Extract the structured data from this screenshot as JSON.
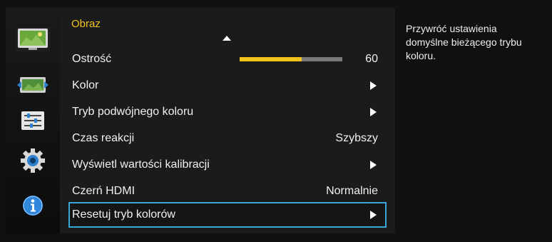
{
  "menu": {
    "title": "Obraz",
    "items": [
      {
        "label": "Ostrość",
        "value": "60",
        "slider_level_percent": 60,
        "kind": "slider"
      },
      {
        "label": "Kolor",
        "kind": "submenu"
      },
      {
        "label": "Tryb podwójnego koloru",
        "kind": "submenu"
      },
      {
        "label": "Czas reakcji",
        "value": "Szybszy",
        "kind": "value"
      },
      {
        "label": "Wyświetl wartości kalibracji",
        "kind": "submenu"
      },
      {
        "label": "Czerń HDMI",
        "value": "Normalnie",
        "kind": "value"
      },
      {
        "label": "Resetuj tryb kolorów",
        "kind": "submenu",
        "selected": true
      }
    ]
  },
  "sidebar": {
    "icons": [
      {
        "name": "picture-icon",
        "selected": true
      },
      {
        "name": "screen-size-icon"
      },
      {
        "name": "settings-sliders-icon"
      },
      {
        "name": "gear-icon"
      },
      {
        "name": "info-icon"
      }
    ]
  },
  "description": {
    "text": "Przywróć ustawienia domyślne bieżącego trybu koloru."
  },
  "colors": {
    "accent_yellow": "#f2c318",
    "selection_border": "#39a6d9",
    "text": "#f0f0f0"
  }
}
